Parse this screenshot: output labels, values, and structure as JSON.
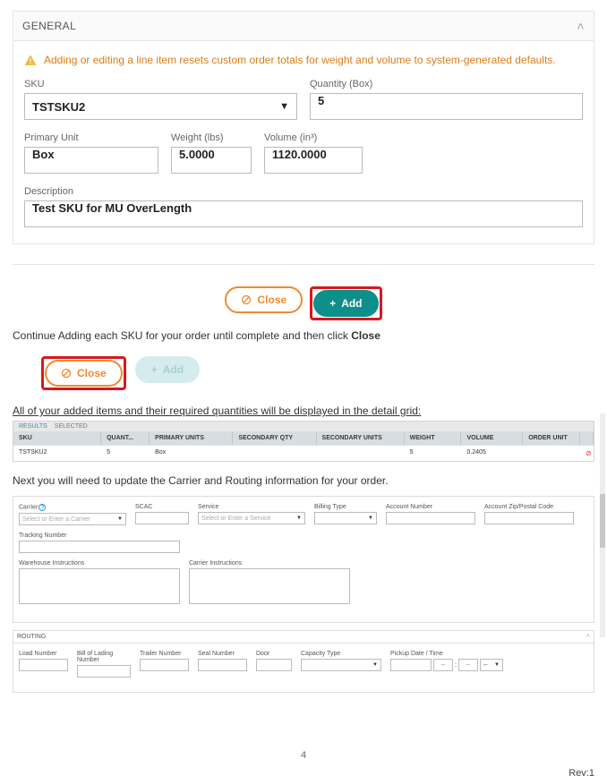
{
  "general": {
    "heading": "GENERAL",
    "warning": "Adding or editing a line item resets custom order totals for weight and volume to system-generated defaults.",
    "sku_label": "SKU",
    "sku_value": "TSTSKU2",
    "qty_label": "Quantity (Box)",
    "qty_value": "5",
    "punit_label": "Primary Unit",
    "punit_value": "Box",
    "weight_label": "Weight (lbs)",
    "weight_value": "5.0000",
    "volume_label": "Volume (in³)",
    "volume_value": "1120.0000",
    "desc_label": "Description",
    "desc_value": "Test SKU for MU OverLength"
  },
  "buttons": {
    "close": "Close",
    "add": "Add"
  },
  "note1_prefix": "Continue Adding each SKU for your order until complete and then click ",
  "note1_bold": "Close",
  "note2": "All of your added items and their required quantities will be displayed in the detail grid:",
  "grid": {
    "tab_results": "RESULTS",
    "tab_selected": "SELECTED",
    "headers": {
      "sku": "SKU",
      "qty": "QUANT...",
      "pu": "PRIMARY UNITS",
      "sq": "SECONDARY QTY",
      "su": "SECONDARY UNITS",
      "wt": "WEIGHT",
      "vol": "VOLUME",
      "ou": "ORDER UNIT"
    },
    "row": {
      "sku": "TSTSKU2",
      "qty": "5",
      "pu": "Box",
      "sq": "",
      "su": "",
      "wt": "5",
      "vol": "0.2405",
      "ou": ""
    }
  },
  "body2": "Next you will need to update the Carrier and Routing information for your order.",
  "carrier": {
    "carrier_label": "Carrier",
    "carrier_placeholder": "Select or Enter a Carrier",
    "scac_label": "SCAC",
    "service_label": "Service",
    "service_placeholder": "Select or Enter a Service",
    "billing_label": "Billing Type",
    "acct_label": "Account Number",
    "zip_label": "Account Zip/Postal Code",
    "tracking_label": "Tracking Number",
    "winstr_label": "Warehouse Instructions",
    "cinstr_label": "Carrier Instructions"
  },
  "routing": {
    "heading": "ROUTING",
    "load_label": "Load Number",
    "bol_label": "Bill of Lading Number",
    "trailer_label": "Trailer Number",
    "seal_label": "Seal Number",
    "door_label": "Door",
    "cap_label": "Capacity Type",
    "pickup_label": "Pickup Date / Time",
    "time_dash": "--",
    "time_colon": ":"
  },
  "footer": {
    "page": "4",
    "rev": "Rev:1"
  }
}
